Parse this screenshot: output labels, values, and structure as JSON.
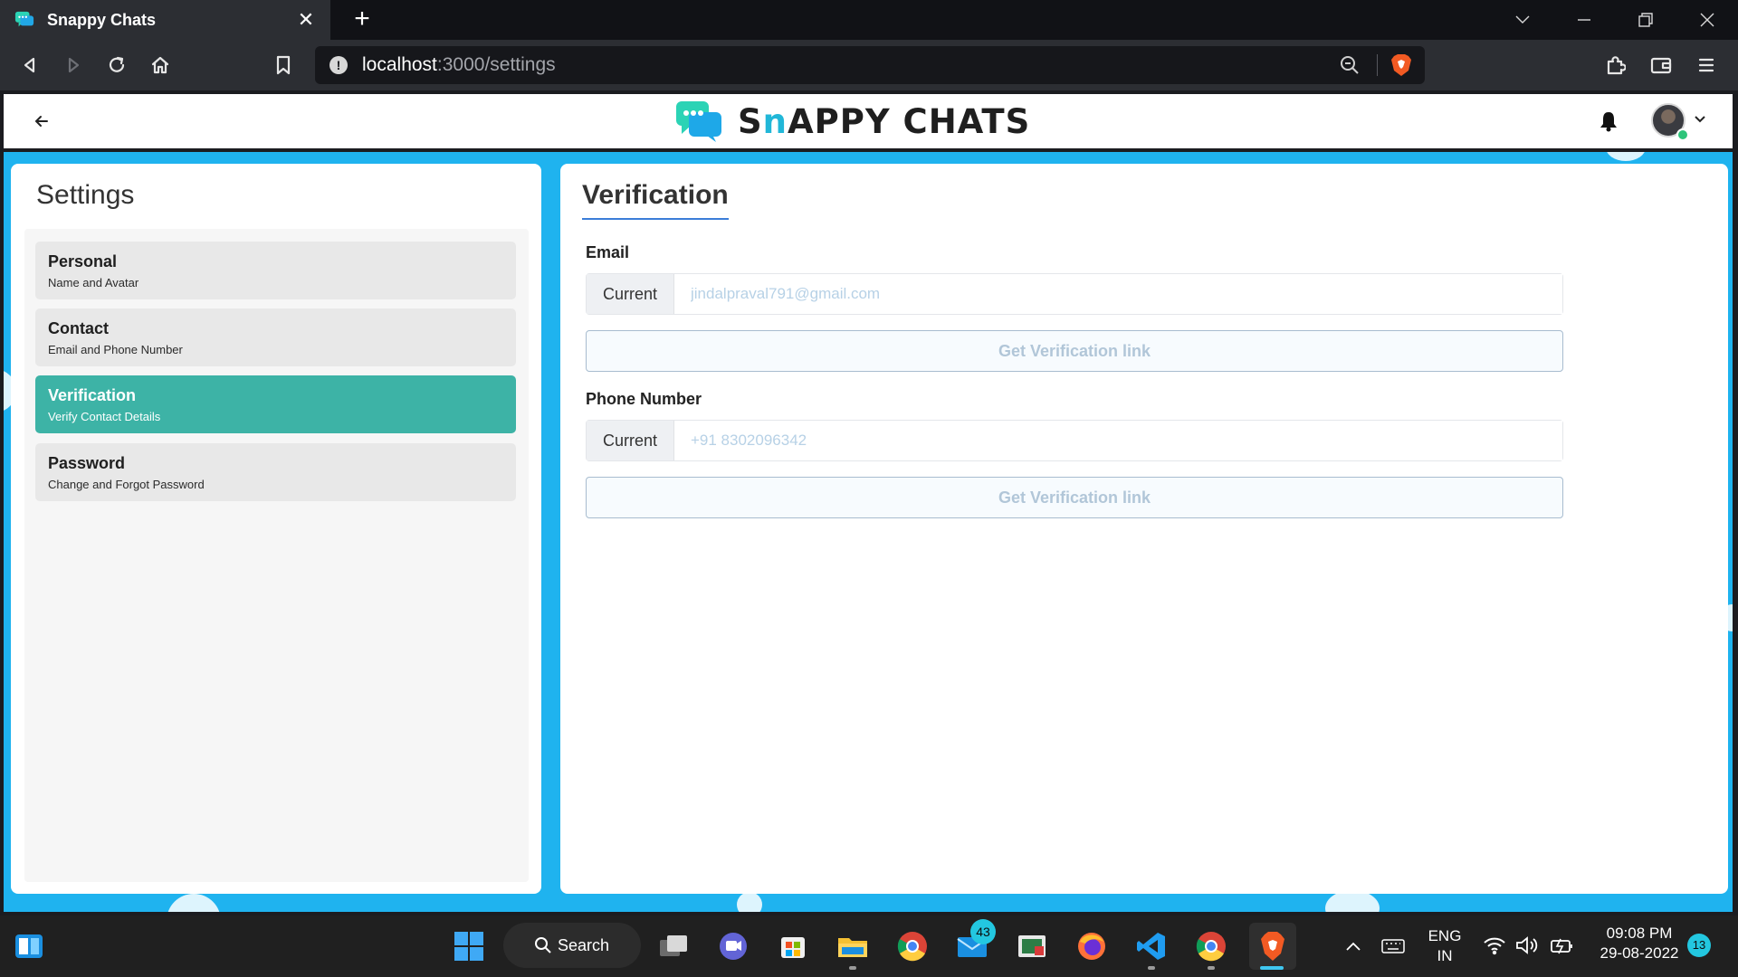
{
  "browser": {
    "tab_title": "Snappy Chats",
    "url_host": "localhost",
    "url_path": ":3000/settings"
  },
  "header": {
    "logo_prefix": "S",
    "logo_n": "n",
    "logo_suffix": "APPY CHATS"
  },
  "sidebar": {
    "title": "Settings",
    "items": [
      {
        "label": "Personal",
        "sub": "Name and Avatar"
      },
      {
        "label": "Contact",
        "sub": "Email and Phone Number"
      },
      {
        "label": "Verification",
        "sub": "Verify Contact Details"
      },
      {
        "label": "Password",
        "sub": "Change and Forgot Password"
      }
    ]
  },
  "content": {
    "title": "Verification",
    "email": {
      "label": "Email",
      "addon": "Current",
      "placeholder": "jindalpraval791@gmail.com",
      "button": "Get Verification link"
    },
    "phone": {
      "label": "Phone Number",
      "addon": "Current",
      "placeholder": "+91 8302096342",
      "button": "Get Verification link"
    }
  },
  "taskbar": {
    "search_label": "Search",
    "mail_badge": "43",
    "lang_line1": "ENG",
    "lang_line2": "IN",
    "time": "09:08 PM",
    "date": "29-08-2022",
    "notification_count": "13"
  },
  "colors": {
    "accent": "#3db3a6",
    "background": "#1fb3ef",
    "title_underline": "#3b7dd8"
  }
}
